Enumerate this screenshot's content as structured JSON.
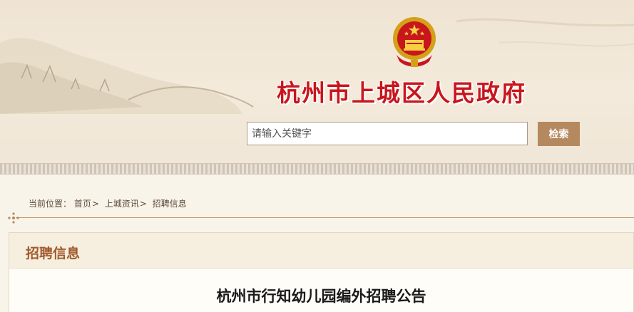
{
  "header": {
    "site_title": "杭州市上城区人民政府",
    "emblem_icon": "national-emblem-icon"
  },
  "search": {
    "placeholder": "请输入关键字",
    "value": "",
    "button_label": "检索"
  },
  "breadcrumb": {
    "prefix": "当前位置：",
    "items": [
      {
        "label": "首页",
        "separator": ">"
      },
      {
        "label": "上城资讯",
        "separator": ">"
      },
      {
        "label": "招聘信息",
        "separator": ""
      }
    ]
  },
  "panel": {
    "section_title": "招聘信息",
    "article_title": "杭州市行知幼儿园编外招聘公告"
  },
  "colors": {
    "brand_red": "#c8161d",
    "button_brown": "#b5895f",
    "section_brown": "#a05a2c"
  }
}
